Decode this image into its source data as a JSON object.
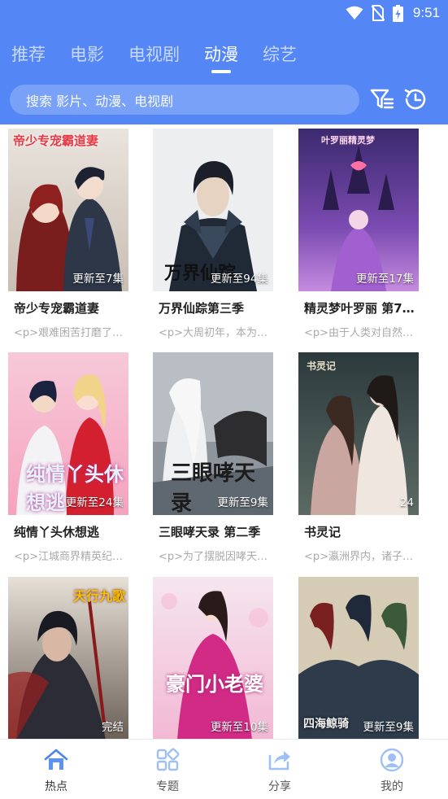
{
  "status_bar": {
    "time": "9:51",
    "icons": [
      "wifi-icon",
      "no-sim-icon",
      "battery-charging-icon"
    ]
  },
  "tabs": [
    {
      "label": "推荐",
      "active": false
    },
    {
      "label": "电影",
      "active": false
    },
    {
      "label": "电视剧",
      "active": false
    },
    {
      "label": "动漫",
      "active": true
    },
    {
      "label": "综艺",
      "active": false
    }
  ],
  "search": {
    "placeholder": "搜索 影片、动漫、电视剧"
  },
  "header_icons": [
    "filter-icon",
    "history-clock-icon"
  ],
  "colors": {
    "header": "#5487f5",
    "active_nav": "#4a86f0"
  },
  "cards": [
    {
      "title": "帝少专宠霸道妻",
      "desc": "<p>艰难困苦打磨了…",
      "badge": "更新至7集",
      "poster_text": "帝少专宠霸道妻"
    },
    {
      "title": "万界仙踪第三季",
      "desc": "<p>大周初年，本为…",
      "badge": "更新至94集",
      "poster_text": "万界仙踪"
    },
    {
      "title": "精灵梦叶罗丽 第7…",
      "desc": "<p>由于人类对自然…",
      "badge": "更新至17集",
      "poster_text": "叶罗丽精灵梦"
    },
    {
      "title": "纯情丫头休想逃",
      "desc": "<p>江城商界精英纪…",
      "badge": "更新至24集",
      "poster_text": "纯情丫头休想逃"
    },
    {
      "title": "三眼哮天录 第二季",
      "desc": "<p>为了摆脱因哮天…",
      "badge": "更新至9集",
      "poster_text": "三眼哮天录"
    },
    {
      "title": "书灵记",
      "desc": "<p>瀛洲界内，诸子…",
      "badge": "24",
      "poster_text": "书灵记"
    },
    {
      "title": "",
      "desc": "",
      "badge": "完结",
      "poster_text": "天行九歌"
    },
    {
      "title": "",
      "desc": "",
      "badge": "更新至10集",
      "poster_text": "豪门小老婆"
    },
    {
      "title": "",
      "desc": "",
      "badge": "更新至9集",
      "poster_text": "四海鲸骑"
    }
  ],
  "bottom_nav": [
    {
      "label": "热点",
      "icon": "home-icon",
      "active": true
    },
    {
      "label": "专题",
      "icon": "grid-icon",
      "active": false
    },
    {
      "label": "分享",
      "icon": "share-icon",
      "active": false
    },
    {
      "label": "我的",
      "icon": "user-icon",
      "active": false
    }
  ]
}
